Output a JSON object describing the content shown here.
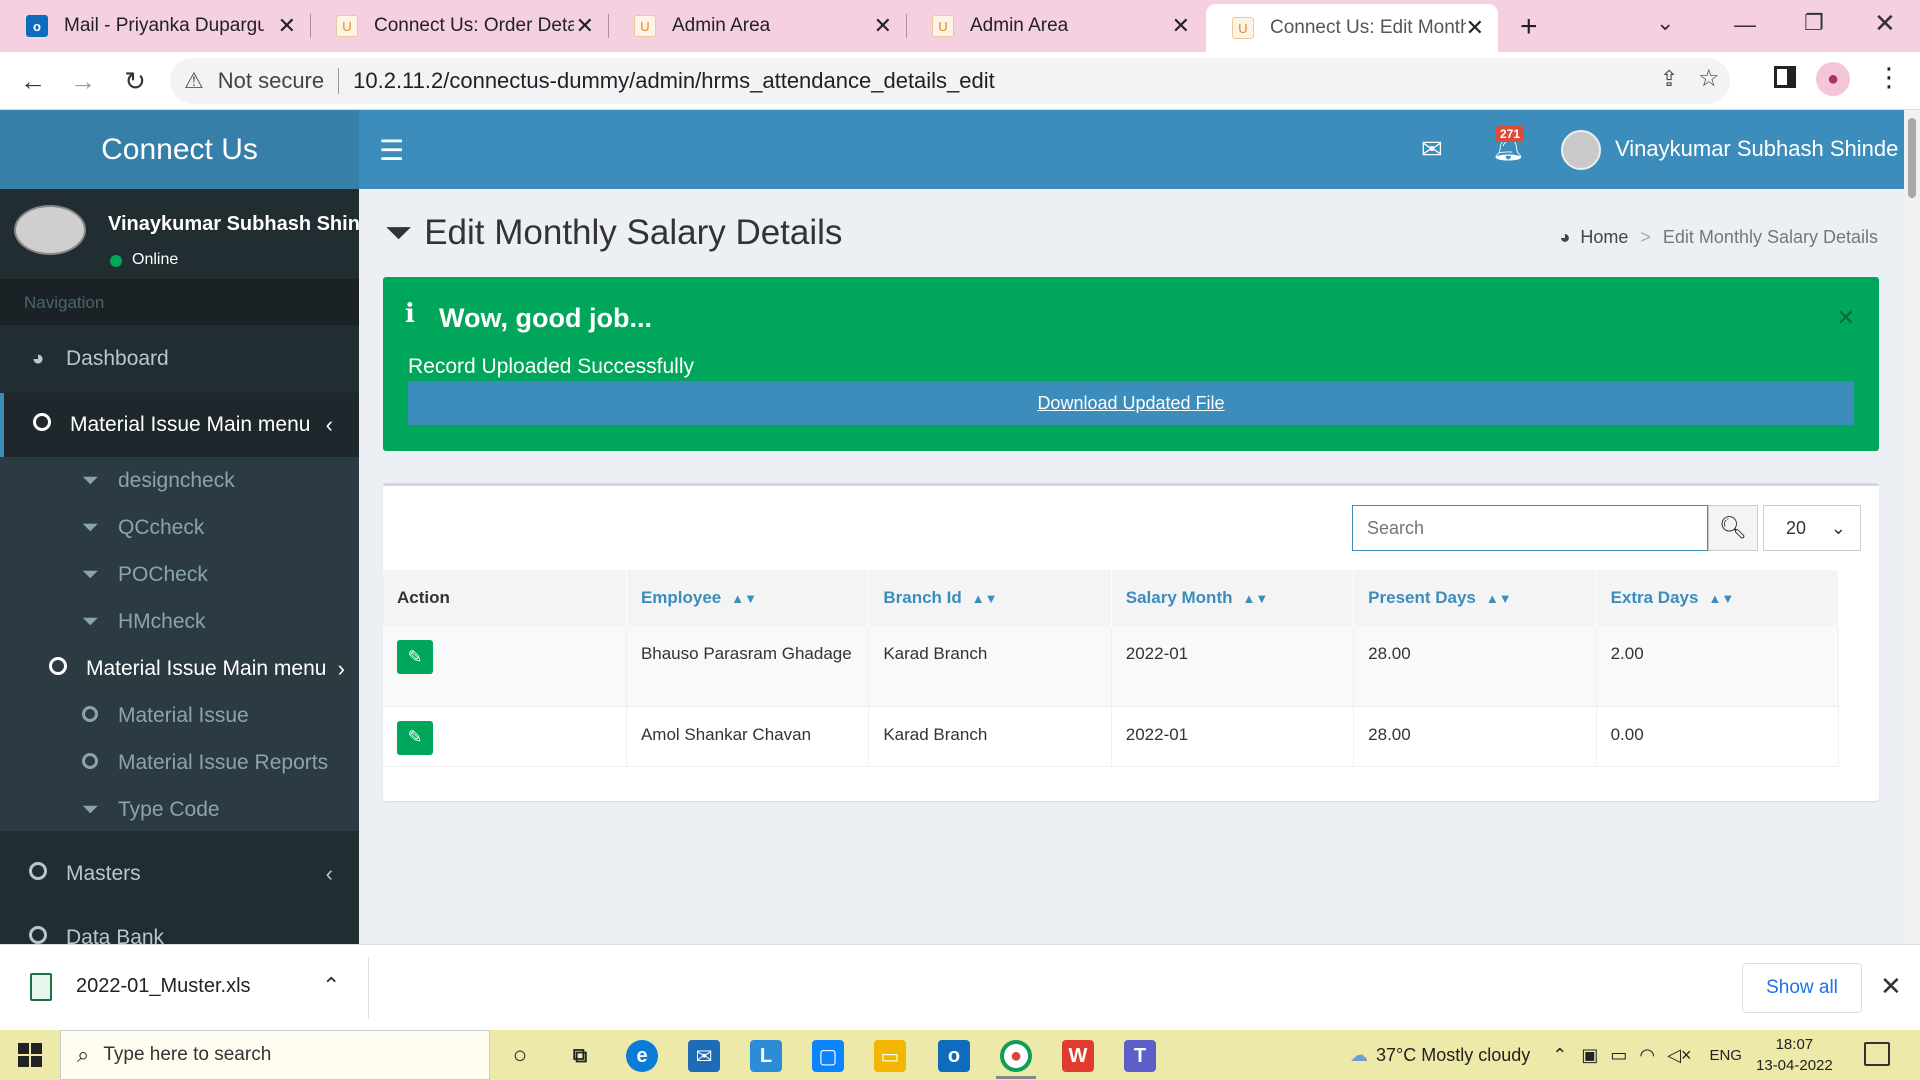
{
  "browser": {
    "tabs": [
      {
        "title": "Mail - Priyanka Dupargu",
        "icon": "outlook-icon"
      },
      {
        "title": "Connect Us: Order Deta",
        "icon": "connectus-favicon"
      },
      {
        "title": "Admin Area",
        "icon": "connectus-favicon"
      },
      {
        "title": "Admin Area",
        "icon": "connectus-favicon"
      },
      {
        "title": "Connect Us: Edit Month",
        "icon": "connectus-favicon",
        "active": true
      }
    ],
    "security_label": "Not secure",
    "url": "10.2.11.2/connectus-dummy/admin/hrms_attendance_details_edit"
  },
  "app": {
    "logo": "Connect Us",
    "notifications_count": "271",
    "user_name": "Vinaykumar Subhash Shinde",
    "user_status": "Online"
  },
  "sidebar": {
    "nav_header": "Navigation",
    "items": [
      {
        "label": "Dashboard",
        "icon": "dashboard-icon"
      },
      {
        "label": "Material Issue Main menu",
        "icon": "circle-icon"
      },
      {
        "label": "designcheck",
        "icon": "filter-icon"
      },
      {
        "label": "QCcheck",
        "icon": "filter-icon"
      },
      {
        "label": "POCheck",
        "icon": "filter-icon"
      },
      {
        "label": "HMcheck",
        "icon": "filter-icon"
      },
      {
        "label": "Material Issue Main menu",
        "icon": "circle-icon"
      },
      {
        "label": "Material Issue",
        "icon": "circle-icon"
      },
      {
        "label": "Material Issue Reports",
        "icon": "circle-icon"
      },
      {
        "label": "Type Code",
        "icon": "filter-icon"
      },
      {
        "label": "Masters",
        "icon": "circle-icon"
      },
      {
        "label": "Data Bank",
        "icon": "circle-icon"
      }
    ]
  },
  "page": {
    "title": "Edit Monthly Salary Details",
    "breadcrumb": {
      "home": "Home",
      "current": "Edit Monthly Salary Details"
    }
  },
  "alert": {
    "heading": "Wow, good job...",
    "message": "Record Uploaded Successfully",
    "download_link": "Download Updated File"
  },
  "table": {
    "search_placeholder": "Search",
    "page_size": "20",
    "columns": [
      "Action",
      "Employee",
      "Branch Id",
      "Salary Month",
      "Present Days",
      "Extra Days"
    ],
    "rows": [
      {
        "employee": "Bhauso Parasram Ghadage",
        "branch": "Karad Branch",
        "month": "2022-01",
        "present": "28.00",
        "extra": "2.00"
      },
      {
        "employee": "Amol Shankar Chavan",
        "branch": "Karad Branch",
        "month": "2022-01",
        "present": "28.00",
        "extra": "0.00"
      }
    ]
  },
  "download_bar": {
    "file_name": "2022-01_Muster.xls",
    "show_all": "Show all"
  },
  "taskbar": {
    "search_placeholder": "Type here to search",
    "weather": "37°C  Mostly cloudy",
    "language": "ENG",
    "time": "18:07",
    "date": "13-04-2022"
  },
  "colors": {
    "header_blue": "#3c8dbc",
    "logo_blue": "#367fa9",
    "sidebar_dark": "#222d32",
    "success_green": "#00a65a",
    "badge_red": "#dd4b39"
  }
}
